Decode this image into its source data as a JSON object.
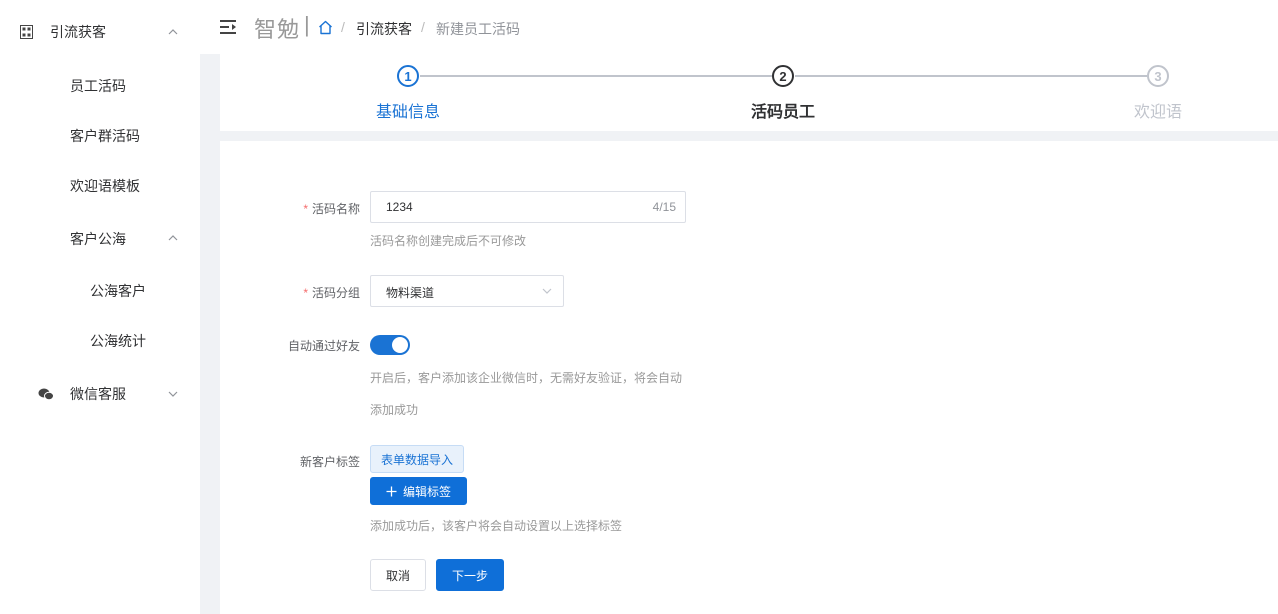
{
  "sidebar": {
    "group_main": {
      "label": "引流获客",
      "icon": "qrcode-icon",
      "expanded": true
    },
    "items": [
      {
        "label": "员工活码"
      },
      {
        "label": "客户群活码"
      },
      {
        "label": "欢迎语模板"
      }
    ],
    "group_sea": {
      "label": "客户公海",
      "expanded": true
    },
    "sea_items": [
      {
        "label": "公海客户"
      },
      {
        "label": "公海统计"
      }
    ],
    "group_wechat": {
      "label": "微信客服",
      "icon": "wechat-icon",
      "expanded": false
    }
  },
  "header": {
    "brand": "智勉",
    "separator": "|",
    "breadcrumb": [
      "引流获客",
      "新建员工活码"
    ],
    "crumb_sep": "/"
  },
  "steps": [
    {
      "num": "1",
      "title": "基础信息",
      "state": "done"
    },
    {
      "num": "2",
      "title": "活码员工",
      "state": "active"
    },
    {
      "num": "3",
      "title": "欢迎语",
      "state": "wait"
    }
  ],
  "form": {
    "name_label": "活码名称",
    "name_value": "1234",
    "name_count": "4/15",
    "name_hint": "活码名称创建完成后不可修改",
    "group_label": "活码分组",
    "group_value": "物料渠道",
    "auto_label": "自动通过好友",
    "auto_on": true,
    "auto_hint_1": "开启后，客户添加该企业微信时，无需好友验证，将会自动",
    "auto_hint_2": "添加成功",
    "tag_label": "新客户标签",
    "tag_value": "表单数据导入",
    "edit_tag_button": "编辑标签",
    "tag_hint": "添加成功后，该客户将会自动设置以上选择标签",
    "cancel_button": "取消",
    "next_button": "下一步"
  },
  "colors": {
    "primary": "#0f6fd8",
    "step_done": "#1a73d4",
    "step_wait": "#c0c4cc",
    "required": "#f56c6c"
  }
}
